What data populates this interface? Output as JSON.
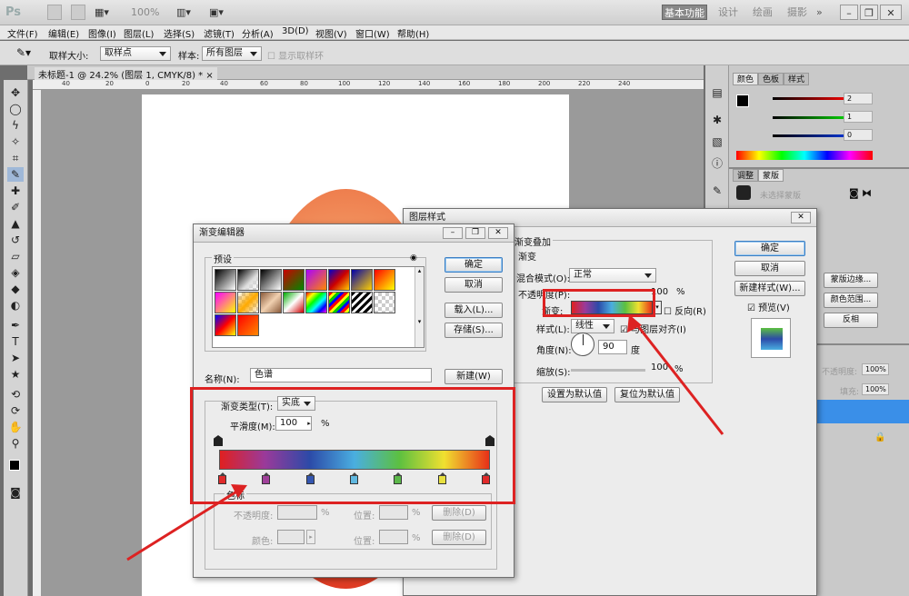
{
  "app": {
    "logo": "Ps",
    "zoom": "100%",
    "workspace": [
      "基本功能",
      "设计",
      "绘画",
      "摄影"
    ],
    "more": "»"
  },
  "menu": [
    "文件(F)",
    "编辑(E)",
    "图像(I)",
    "图层(L)",
    "选择(S)",
    "滤镜(T)",
    "分析(A)",
    "3D(D)",
    "视图(V)",
    "窗口(W)",
    "帮助(H)"
  ],
  "options": {
    "sample_size_label": "取样大小:",
    "sample_size_value": "取样点",
    "sample_label": "样本:",
    "sample_value": "所有图层",
    "show_ring": "显示取样环"
  },
  "document": {
    "tab": "未标题-1 @ 24.2% (图层 1, CMYK/8) *",
    "close": "×",
    "ruler_ticks": [
      "40",
      "20",
      "0",
      "20",
      "40",
      "60",
      "80",
      "100",
      "120",
      "140",
      "160",
      "180",
      "200",
      "220",
      "240"
    ]
  },
  "color_panel": {
    "tabs": [
      "颜色",
      "色板",
      "样式"
    ],
    "r": "2",
    "g": "1",
    "b": "0"
  },
  "adjust_panel": {
    "tabs": [
      "调整",
      "蒙版"
    ],
    "mask_label": "未选择蒙版",
    "buttons": [
      "蒙版边缘...",
      "颜色范围...",
      "反相"
    ]
  },
  "layers_panel": {
    "opacity_label": "不透明度:",
    "opacity_value": "100%",
    "fill_label": "填充:",
    "fill_value": "100%"
  },
  "gradient_editor": {
    "title": "渐变编辑器",
    "presets_label": "预设",
    "ok": "确定",
    "cancel": "取消",
    "load": "载入(L)...",
    "save": "存储(S)...",
    "name_label": "名称(N):",
    "name_value": "色谱",
    "new": "新建(W)",
    "type_label": "渐变类型(T):",
    "type_value": "实底",
    "smooth_label": "平滑度(M):",
    "smooth_value": "100",
    "percent": "%",
    "stops_label": "色标",
    "opacity_label": "不透明度:",
    "position_label": "位置:",
    "delete": "删除(D)",
    "color_label": "颜色:",
    "stop_colors": [
      "#e02a2a",
      "#a0409a",
      "#3456b0",
      "#60b8e0",
      "#5cb84a",
      "#e8e040",
      "#e02a2a"
    ],
    "gradient_colors": [
      "#e02020",
      "#9a3a9a",
      "#2c4aa8",
      "#4aaee0",
      "#5cc040",
      "#f0e030",
      "#e83018"
    ]
  },
  "layer_style": {
    "title": "图层样式",
    "section": "渐变叠加",
    "subsection": "渐变",
    "blend_label": "混合模式(O):",
    "blend_value": "正常",
    "opacity_label": "不透明度(P):",
    "opacity_value": "100",
    "percent": "%",
    "gradient_label": "渐变:",
    "reverse": "反向(R)",
    "style_label": "样式(L):",
    "style_value": "线性",
    "align": "与图层对齐(I)",
    "angle_label": "角度(N):",
    "angle_value": "90",
    "degree": "度",
    "scale_label": "缩放(S):",
    "scale_value": "100",
    "set_default": "设置为默认值",
    "reset_default": "复位为默认值",
    "ok": "确定",
    "cancel": "取消",
    "new_style": "新建样式(W)...",
    "preview": "预览(V)"
  }
}
